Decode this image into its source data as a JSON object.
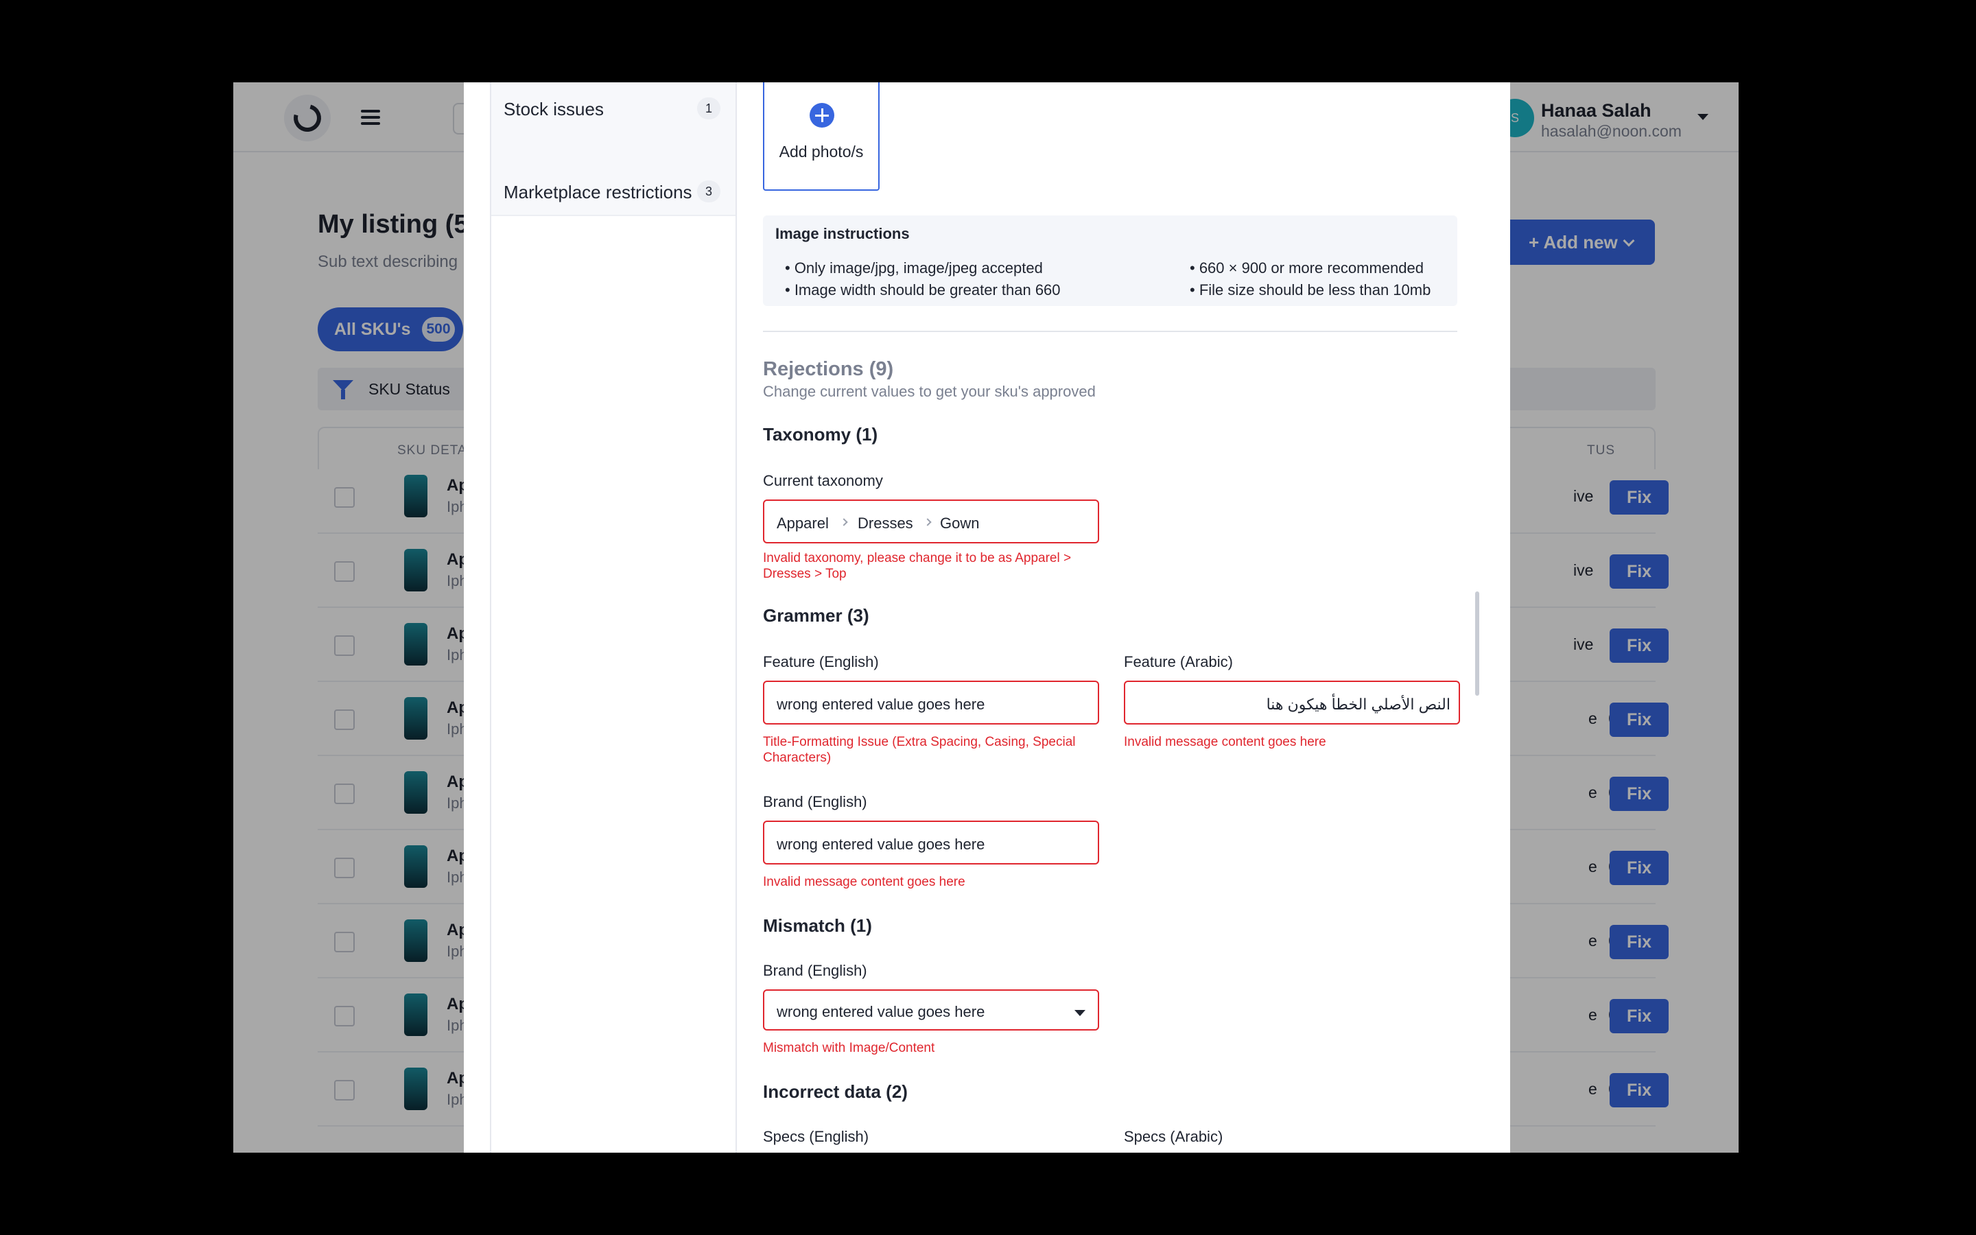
{
  "app": {
    "user": {
      "initials": "S",
      "name": "Hanaa Salah",
      "email": "hasalah@noon.com"
    },
    "page_title": "My listing (5",
    "page_subtitle": "Sub text describing",
    "add_new_label": "+ Add new",
    "all_skus": {
      "label": "All SKU's",
      "count": "500"
    },
    "filter_label": "SKU Status",
    "columns": {
      "sku": "SKU DETAI",
      "status": "TUS"
    },
    "rows": [
      {
        "name": "Ap",
        "sub": "Iph",
        "status": "ive",
        "fix": "Fix"
      },
      {
        "name": "Ap",
        "sub": "Iph",
        "status": "ive",
        "fix": "Fix"
      },
      {
        "name": "Ap",
        "sub": "Iph",
        "status": "ive",
        "fix": "Fix"
      },
      {
        "name": "Ap",
        "sub": "Iph",
        "status": "e",
        "fix": "Fix"
      },
      {
        "name": "Ap",
        "sub": "Iph",
        "status": "e",
        "fix": "Fix"
      },
      {
        "name": "Ap",
        "sub": "Iph",
        "status": "e",
        "fix": "Fix"
      },
      {
        "name": "Ap",
        "sub": "Iph",
        "status": "e",
        "fix": "Fix"
      },
      {
        "name": "Ap",
        "sub": "Iph",
        "status": "e",
        "fix": "Fix"
      },
      {
        "name": "Ap",
        "sub": "Iph",
        "status": "e",
        "fix": "Fix"
      }
    ]
  },
  "modal": {
    "sidebar": [
      {
        "label": "Stock issues",
        "count": "1"
      },
      {
        "label": "Marketplace restrictions",
        "count": "3"
      }
    ],
    "add_photo_label": "Add photo/s",
    "image_instructions": {
      "title": "Image instructions",
      "items": [
        "• Only image/jpg, image/jpeg accepted",
        "• Image width should be greater than 660",
        "• 660 × 900 or more recommended",
        "• File size should be less than 10mb"
      ]
    },
    "rejections": {
      "title": "Rejections (9)",
      "subtitle": "Change current values to get your sku's approved"
    },
    "taxonomy": {
      "title": "Taxonomy (1)",
      "label": "Current taxonomy",
      "crumbs": [
        "Apparel",
        "Dresses",
        "Gown"
      ],
      "error": "Invalid taxonomy, please change it to be as  Apparel > Dresses > Top"
    },
    "grammer": {
      "title": "Grammer (3)",
      "feature_en": {
        "label": "Feature (English)",
        "value": "wrong entered value goes here",
        "error": "Title-Formatting Issue (Extra Spacing, Casing, Special Characters)"
      },
      "feature_ar": {
        "label": "Feature (Arabic)",
        "value": "النص الأصلي الخطأ هيكون هنا",
        "error": "Invalid message content goes here"
      },
      "brand_en": {
        "label": "Brand (English)",
        "value": "wrong entered value goes here",
        "error": "Invalid message content goes here"
      }
    },
    "mismatch": {
      "title": "Mismatch (1)",
      "brand_en": {
        "label": "Brand (English)",
        "value": "wrong entered value goes here",
        "error": "Mismatch with Image/Content"
      }
    },
    "incorrect": {
      "title": "Incorrect data (2)",
      "specs_en_label": "Specs (English)",
      "specs_ar_label": "Specs (Arabic)"
    }
  },
  "colors": {
    "accent": "#3866df",
    "error": "#e0262e",
    "text": "#1f2430",
    "muted": "#7a8090"
  }
}
